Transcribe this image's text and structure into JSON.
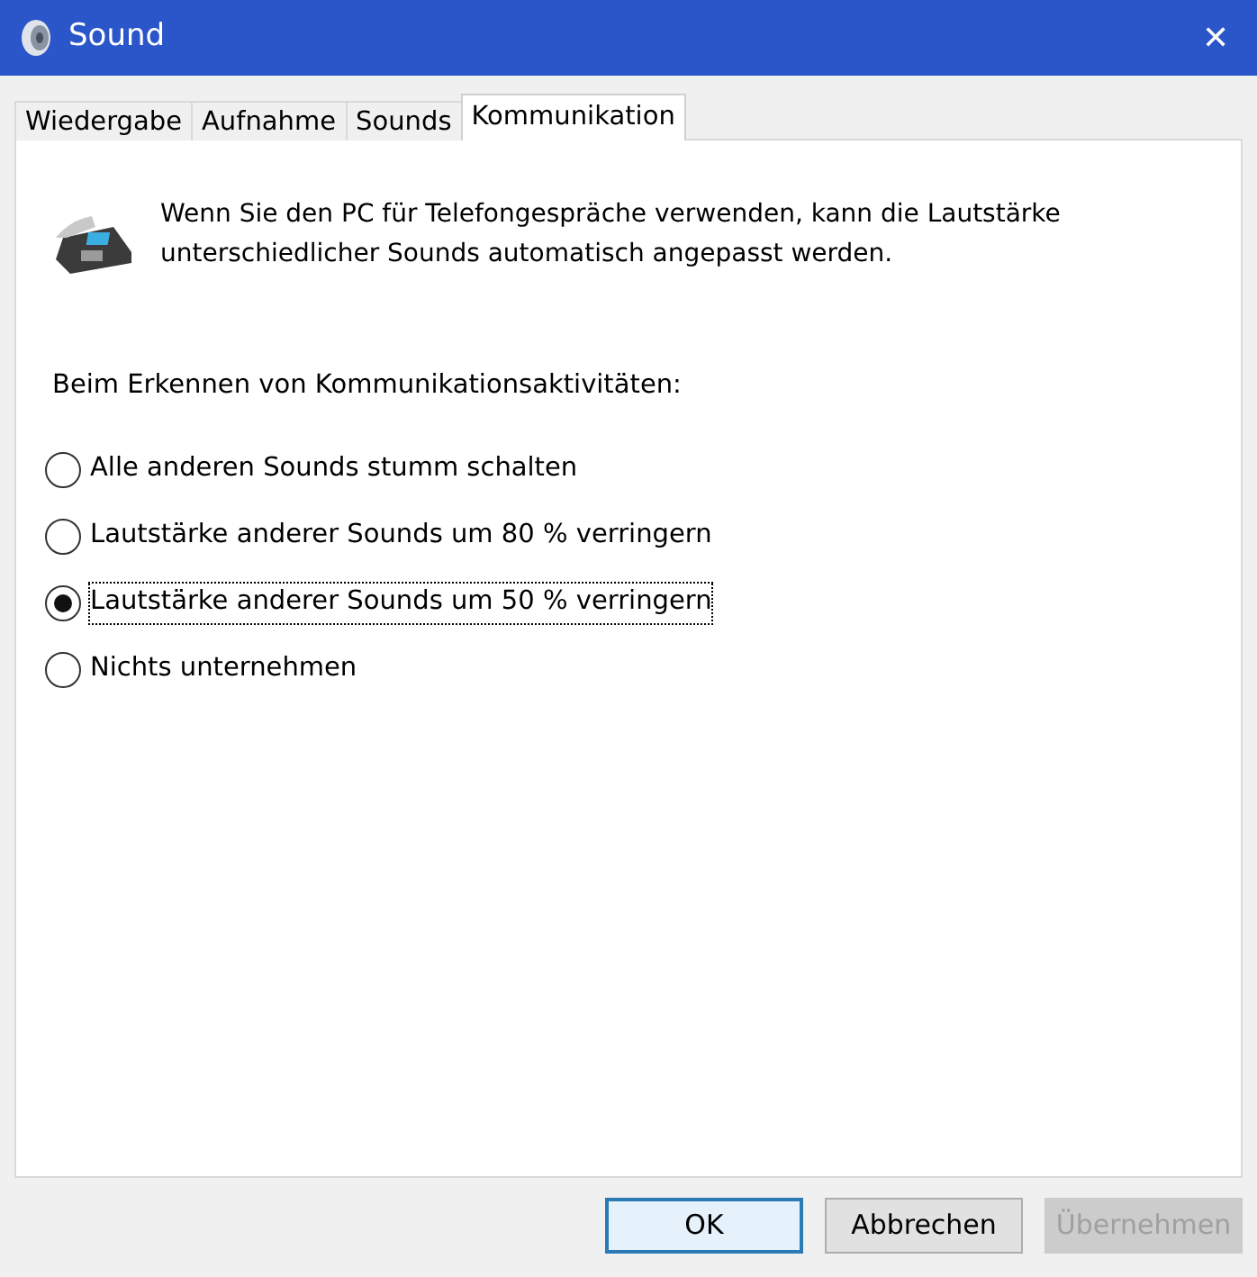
{
  "window": {
    "title": "Sound",
    "close": "✕"
  },
  "tabs": [
    {
      "label": "Wiedergabe",
      "selected": false
    },
    {
      "label": "Aufnahme",
      "selected": false
    },
    {
      "label": "Sounds",
      "selected": false
    },
    {
      "label": "Kommunikation",
      "selected": true
    }
  ],
  "intro": "Wenn Sie den PC für Telefongespräche verwenden, kann die Lautstärke unterschiedlicher Sounds automatisch angepasst werden.",
  "group_label": "Beim Erkennen von Kommunikationsaktivitäten:",
  "options": [
    {
      "label": "Alle anderen Sounds stumm schalten",
      "selected": false
    },
    {
      "label": "Lautstärke anderer Sounds um 80 % verringern",
      "selected": false
    },
    {
      "label": "Lautstärke anderer Sounds um 50 % verringern",
      "selected": true
    },
    {
      "label": "Nichts unternehmen",
      "selected": false
    }
  ],
  "buttons": [
    {
      "label": "OK",
      "default": true,
      "disabled": false
    },
    {
      "label": "Abbrechen",
      "default": false,
      "disabled": false
    },
    {
      "label": "Übernehmen",
      "default": false,
      "disabled": true
    }
  ]
}
